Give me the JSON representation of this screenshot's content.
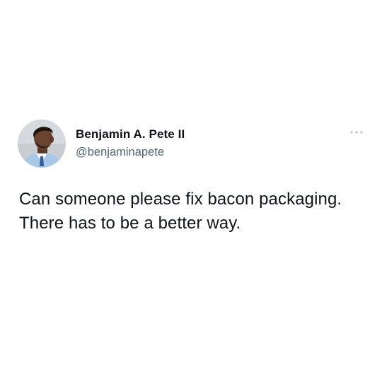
{
  "tweet": {
    "author": {
      "display_name": "Benjamin A. Pete II",
      "handle": "@benjaminapete",
      "avatar_icon": "profile-photo"
    },
    "text": "Can someone please fix bacon packaging. There has to be a better way.",
    "more_icon": "more-dots-icon"
  },
  "colors": {
    "background": "#ffffff",
    "primary_text": "#0f1419",
    "secondary_text": "#536471",
    "more_dots": "#b8c0c8"
  }
}
